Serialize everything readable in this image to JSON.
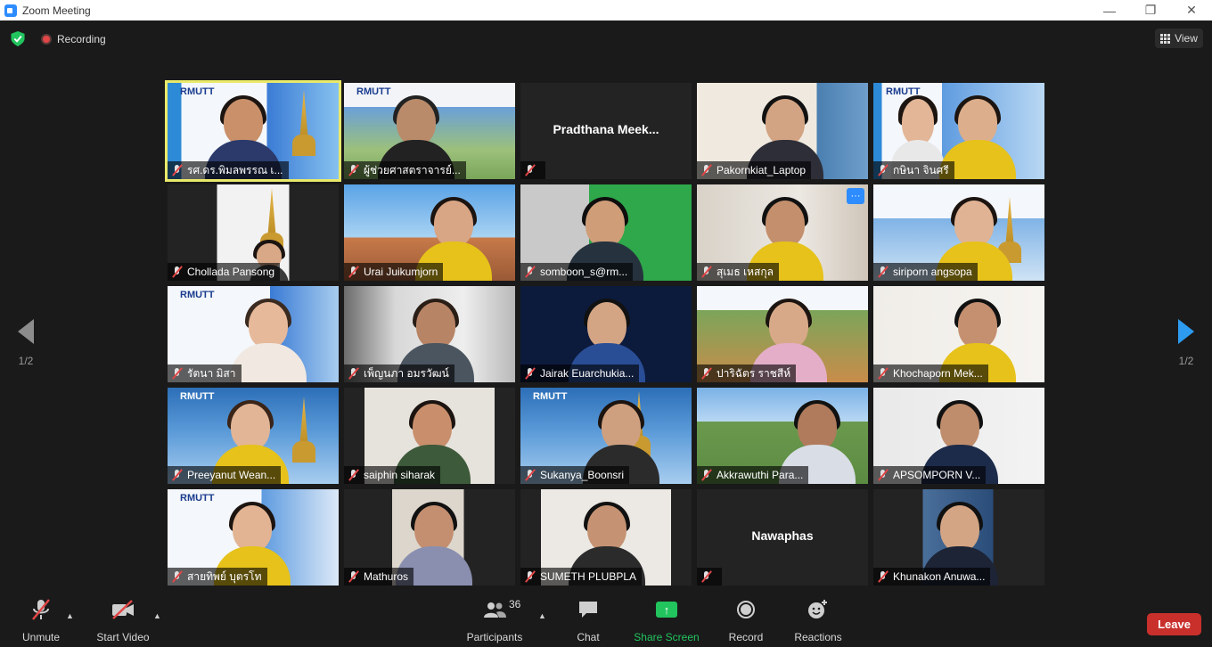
{
  "window": {
    "title": "Zoom Meeting"
  },
  "topbar": {
    "recording_label": "Recording",
    "view_label": "View"
  },
  "pager": {
    "left_page": "1/2",
    "right_page": "1/2"
  },
  "colors": {
    "active_speaker_outline": "#e9e96a",
    "muted_red": "#e24646",
    "share_green": "#22c45e",
    "leave_red": "#c9302c",
    "accent_blue": "#2d8cff"
  },
  "tiles": [
    {
      "name": "รศ.ดร.พิมลพรรณ เ...",
      "active": true,
      "video": true
    },
    {
      "name": "ผู้ช่วยศาสตราจารย์...",
      "video": true
    },
    {
      "name": "Pradthana  Meek...",
      "video": false,
      "center_name": "Pradthana  Meek..."
    },
    {
      "name": "Pakornkiat_Laptop",
      "video": true
    },
    {
      "name": "กษินา  จินศรี",
      "video": true
    },
    {
      "name": "Chollada Pansong",
      "video": true
    },
    {
      "name": "Urai Juikumjorn",
      "video": true
    },
    {
      "name": "somboon_s@rm...",
      "video": true
    },
    {
      "name": "สุเมธ เหสกุล",
      "video": true,
      "more": "···"
    },
    {
      "name": "siriporn angsopa",
      "video": true
    },
    {
      "name": "รัตนา มิสา",
      "video": true
    },
    {
      "name": "เพ็ญนภา  อมรวัฒน์",
      "video": true
    },
    {
      "name": "Jairak Euarchukia...",
      "video": true
    },
    {
      "name": "ปาริฉัตร  ราชสีห์",
      "video": true
    },
    {
      "name": "Khochaporn Mek...",
      "video": true
    },
    {
      "name": "Preeyanut Wean...",
      "video": true
    },
    {
      "name": "saiphin siharak",
      "video": true
    },
    {
      "name": "Sukanya_Boonsri",
      "video": true
    },
    {
      "name": "Akkrawuthi Para...",
      "video": true
    },
    {
      "name": "APSOMPORN V...",
      "video": true
    },
    {
      "name": "สายทิพย์  บุตรโท",
      "video": true
    },
    {
      "name": "Mathuros",
      "video": true
    },
    {
      "name": "SUMETH PLUBPLA",
      "video": true
    },
    {
      "name": "",
      "video": false,
      "center_name": "Nawaphas"
    },
    {
      "name": "Khunakon Anuwa...",
      "video": true
    }
  ],
  "toolbar": {
    "unmute": "Unmute",
    "start_video": "Start Video",
    "participants": "Participants",
    "participant_count": "36",
    "chat": "Chat",
    "share_screen": "Share Screen",
    "record": "Record",
    "reactions": "Reactions",
    "leave": "Leave"
  }
}
